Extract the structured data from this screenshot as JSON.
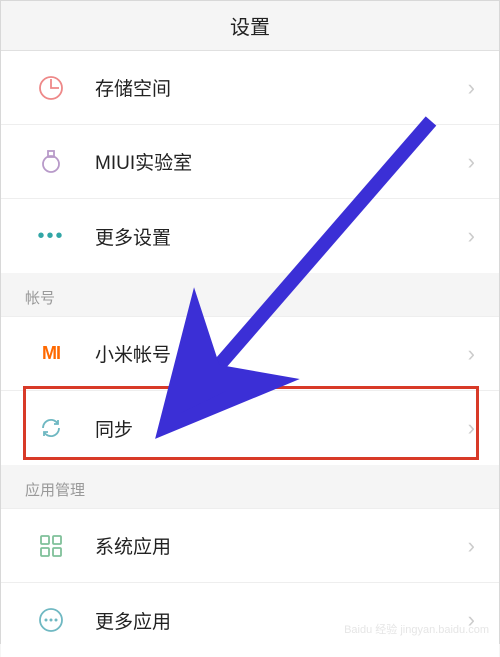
{
  "header": {
    "title": "设置"
  },
  "groups": [
    {
      "items": [
        {
          "id": "storage",
          "label": "存储空间"
        },
        {
          "id": "miui-lab",
          "label": "MIUI实验室"
        },
        {
          "id": "more-settings",
          "label": "更多设置"
        }
      ]
    },
    {
      "header": "帐号",
      "items": [
        {
          "id": "mi-account",
          "label": "小米帐号"
        },
        {
          "id": "sync",
          "label": "同步",
          "highlight": true
        }
      ]
    },
    {
      "header": "应用管理",
      "items": [
        {
          "id": "system-apps",
          "label": "系统应用"
        },
        {
          "id": "more-apps",
          "label": "更多应用"
        }
      ]
    }
  ],
  "annotations": {
    "arrow_color": "#3b2fd6",
    "highlight_color": "#d83a28"
  },
  "watermark": "Baidu 经验 jingyan.baidu.com"
}
